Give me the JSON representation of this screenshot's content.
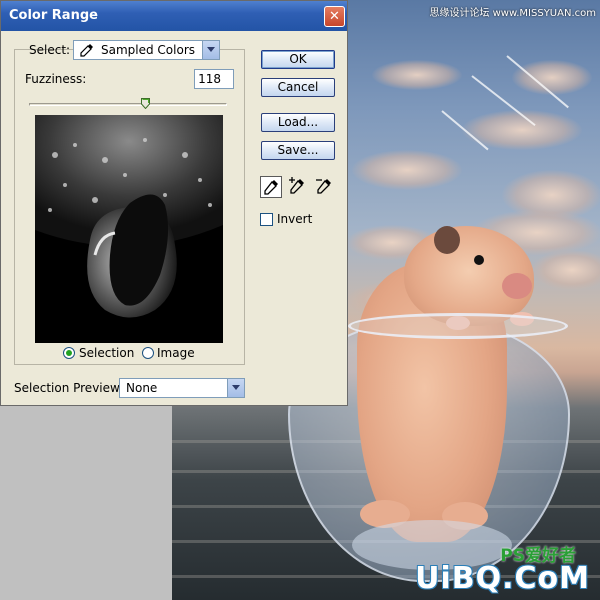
{
  "dialog": {
    "title": "Color Range",
    "close_label": "✕",
    "select_label": "Select:",
    "select_value": "Sampled Colors",
    "fuzziness_label": "Fuzziness:",
    "fuzziness_value": "118",
    "fuzziness_fraction": 0.59,
    "radio_selection": "Selection",
    "radio_image": "Image",
    "radio_selected": "Selection",
    "preview_mode_label": "Selection Preview:",
    "preview_mode_value": "None",
    "buttons": {
      "ok": "OK",
      "cancel": "Cancel",
      "load": "Load...",
      "save": "Save..."
    },
    "tools": [
      "eyedropper-icon",
      "eyedropper-plus-icon",
      "eyedropper-minus-icon"
    ],
    "invert_label": "Invert",
    "invert_checked": false
  },
  "watermarks": {
    "top": "思缘设计论坛 www.MISSYUAN.com",
    "bottom_logo": "UiBQ.CoM",
    "bottom_small": "PS爱好者"
  },
  "colors": {
    "titlebar": "#2354a6",
    "dialog_bg": "#ece9d8",
    "close_button": "#c8462a"
  }
}
